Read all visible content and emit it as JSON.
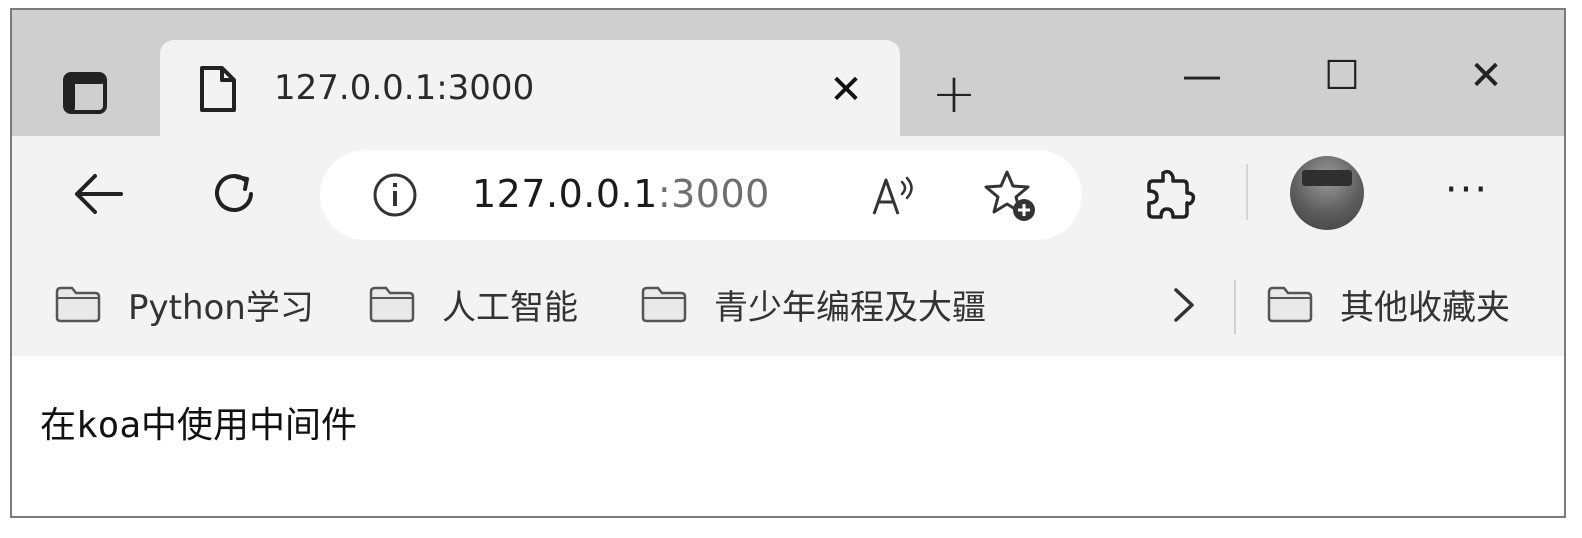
{
  "tab": {
    "title": "127.0.0.1:3000",
    "close_glyph": "✕"
  },
  "newtab": {
    "glyph": "+"
  },
  "window_controls": {
    "minimize": "—",
    "maximize": "☐",
    "close": "✕"
  },
  "toolbar": {
    "url_host": "127.0.0.1",
    "url_port": ":3000",
    "more_glyph": "···"
  },
  "favorites": [
    {
      "label": "Python学习",
      "icon": "folder-icon"
    },
    {
      "label": "人工智能",
      "icon": "folder-icon"
    },
    {
      "label": "青少年编程及大疆",
      "icon": "folder-icon"
    }
  ],
  "other_favorites": {
    "label": "其他收藏夹",
    "icon": "folder-icon"
  },
  "page": {
    "text": "在koa中使用中间件"
  },
  "icons": [
    "tab-actions-icon",
    "page-icon",
    "back-icon",
    "refresh-icon",
    "info-icon",
    "read-aloud-icon",
    "add-favorite-icon",
    "extensions-icon",
    "profile-avatar",
    "chevron-right-icon"
  ]
}
